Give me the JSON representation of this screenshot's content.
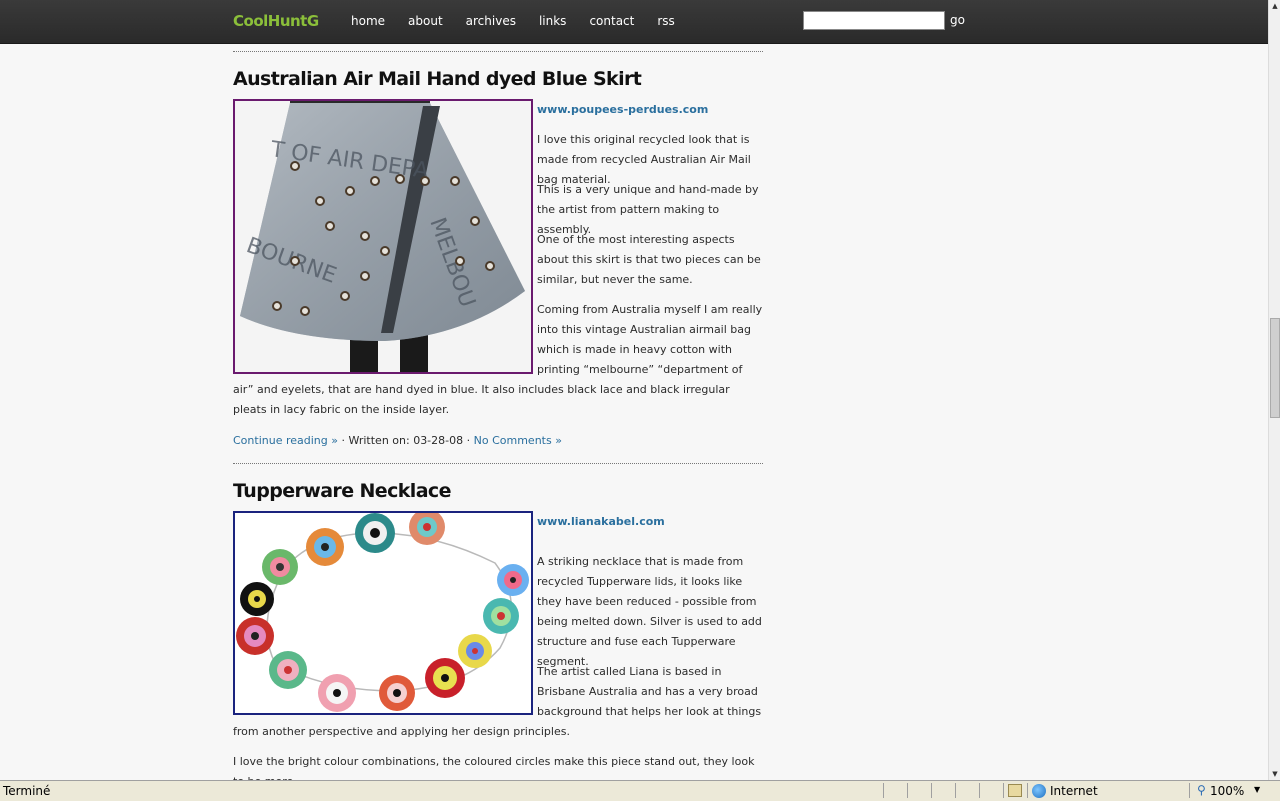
{
  "header": {
    "logo": "CoolHuntG",
    "nav": [
      "home",
      "about",
      "archives",
      "links",
      "contact",
      "rss"
    ],
    "search_placeholder": "",
    "go_label": "go"
  },
  "posts": [
    {
      "title": "Australian Air Mail Hand dyed Blue Skirt",
      "link": "www.poupees-perdues.com",
      "paragraphs": [
        "I love this original recycled look that is made from recycled Australian Air Mail bag material.",
        "This is a very unique and hand-made by the artist from pattern making to assembly.",
        "One of the most interesting aspects about this skirt is that two pieces can be similar, but never the same.",
        "Coming from Australia myself I am really into this vintage Australian airmail bag which is made in heavy cotton with printing “melbourne” “department of air” and eyelets, that are hand dyed in blue. It also includes black lace and black irregular pleats in lacy fabric on the inside layer."
      ],
      "continue": "Continue reading »",
      "written_prefix": "· Written on: 03-28-08 ·",
      "comments": "No Comments »",
      "image_border": "#6a1a6e",
      "image_text_1": "T OF AIR  DEPA",
      "image_text_2": "MELBOU",
      "image_text_3": "BOURNE"
    },
    {
      "title": "Tupperware Necklace",
      "link": "www.lianakabel.com",
      "paragraphs": [
        "A striking necklace that is made from recycled Tupperware lids, it looks like they have been reduced - possible from being melted down. Silver is used to add structure and fuse each Tupperware segment.",
        "The artist called Liana is based in Brisbane Australia and has a very broad background that helps her look at things from another perspective and applying her design principles.",
        "I love the bright colour combinations, the coloured circles make this piece stand out, they look to be more"
      ],
      "image_border": "#1a237e"
    }
  ],
  "status": {
    "text": "Terminé",
    "zone": "Internet",
    "zoom": "100%"
  },
  "colors": {
    "topbar": "#2e2e2e",
    "logo": "#8bbf3a",
    "link": "#2a6f9e"
  }
}
